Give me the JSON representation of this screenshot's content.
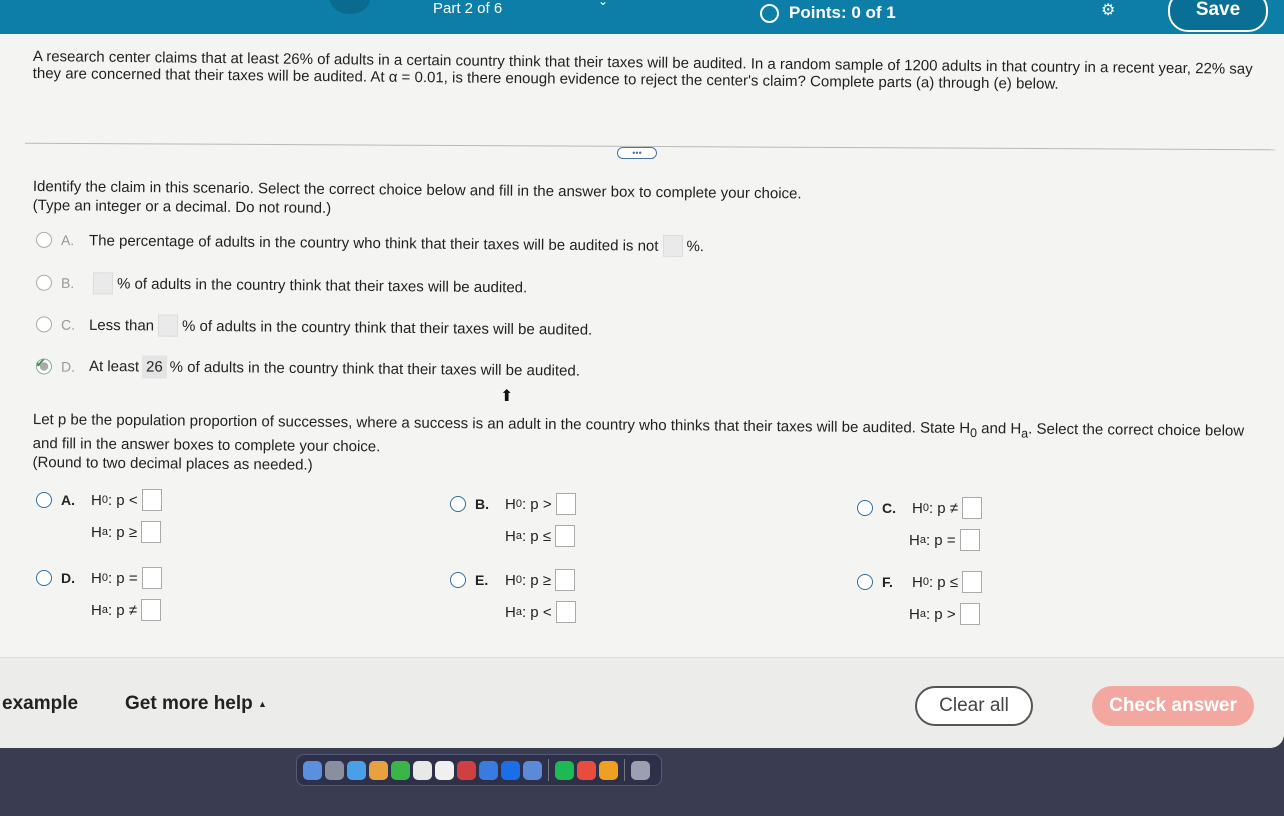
{
  "topbar": {
    "part": "Part 2 of 6",
    "points": "Points: 0 of 1",
    "save_label": "Save"
  },
  "problem_text": "A research center claims that at least 26% of adults in a certain country think that their taxes will be audited. In a random sample of 1200 adults in that country in a recent year, 22% say they are concerned that their taxes will be audited. At α = 0.01, is there enough evidence to reject the center's claim? Complete parts (a) through (e) below.",
  "more_label": "•••",
  "claim": {
    "instruction": "Identify the claim in this scenario. Select the correct choice below and fill in the answer box to complete your choice.",
    "note": "(Type an integer or a decimal. Do not round.)",
    "options": [
      {
        "letter": "A.",
        "pre": "The percentage of adults in the country who think that their taxes will be audited is not",
        "post": "%."
      },
      {
        "letter": "B.",
        "pre": "",
        "post": "% of adults in the country think that their taxes will be audited."
      },
      {
        "letter": "C.",
        "pre": "Less than",
        "post": "% of adults in the country think that their taxes will be audited."
      },
      {
        "letter": "D.",
        "pre": "At least",
        "value": "26",
        "post": "% of adults in the country think that their taxes will be audited."
      }
    ],
    "selected_icon": "check-icon"
  },
  "hypothesis": {
    "instruction": "Let p be the population proportion of successes, where a success is an adult in the country who  thinks that their taxes will be audited. State H",
    "instruction_sub0": "0",
    "instruction_mid": " and H",
    "instruction_suba": "a",
    "instruction_end": ". Select the correct choice below and fill in the answer boxes to complete your choice.",
    "note": "(Round to two decimal places as needed.)",
    "h0_label": "H",
    "ha_label": "H",
    "sub0": "0",
    "suba": "a",
    "options": [
      {
        "letter": "A.",
        "h0": ": p <",
        "ha": ": p ≥"
      },
      {
        "letter": "B.",
        "h0": ": p >",
        "ha": ": p ≤"
      },
      {
        "letter": "C.",
        "h0": ": p ≠",
        "ha": ": p ="
      },
      {
        "letter": "D.",
        "h0": ": p =",
        "ha": ": p ≠"
      },
      {
        "letter": "E.",
        "h0": ": p ≥",
        "ha": ": p <"
      },
      {
        "letter": "F.",
        "h0": ": p ≤",
        "ha": ": p >"
      }
    ]
  },
  "bottom": {
    "example": "example",
    "help": "Get more help",
    "help_caret": "▲",
    "clear": "Clear all",
    "check": "Check answer"
  },
  "colors": {
    "topbar": "#0d7ea8",
    "check_button": "#f2a8a0"
  }
}
